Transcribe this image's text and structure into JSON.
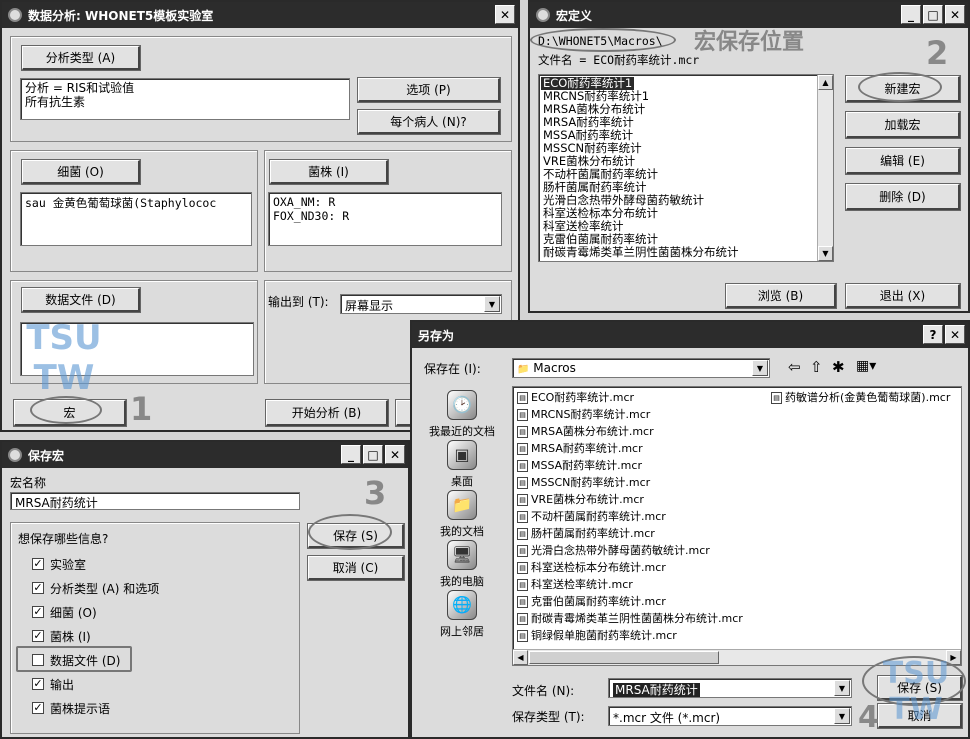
{
  "analysis_window": {
    "title": "数据分析: WHONET5模板实验室",
    "analysis_type_button": "分析类型 (A)",
    "analysis_type_text": [
      "分析 = RIS和试验值",
      "所有抗生素"
    ],
    "options_button": "选项 (P)",
    "per_patient_button": "每个病人 (N)?",
    "organism_button": "细菌 (O)",
    "organism_text": "sau   金黄色葡萄球菌(Staphylococ",
    "strain_button": "菌株 (I)",
    "strain_lines": [
      "OXA_NM:   R",
      "FOX_ND30:  R"
    ],
    "data_file_button": "数据文件 (D)",
    "output_label": "输出到 (T):",
    "output_value": "屏幕显示",
    "macro_button": "宏",
    "start_button": "开始分析 (B)"
  },
  "macro_window": {
    "title": "宏定义",
    "path": "D:\\WHONET5\\Macros\\",
    "filename_line": "文件名 = ECO耐药率统计.mcr",
    "items": [
      "ECO耐药率统计1",
      "MRCNS耐药率统计1",
      "MRSA菌株分布统计",
      "MRSA耐药率统计",
      "MSSA耐药率统计",
      "MSSCN耐药率统计",
      "VRE菌株分布统计",
      "不动杆菌属耐药率统计",
      "肠杆菌属耐药率统计",
      "光滑白念热带外酵母菌药敏统计",
      "科室送检标本分布统计",
      "科室送检率统计",
      "克雷伯菌属耐药率统计",
      "耐碳青霉烯类革兰阴性菌菌株分布统计"
    ],
    "new_button": "新建宏",
    "load_button": "加载宏",
    "edit_button": "编辑 (E)",
    "delete_button": "删除 (D)",
    "browse_button": "浏览 (B)",
    "exit_button": "退出 (X)"
  },
  "save_macro_window": {
    "title": "保存宏",
    "name_label": "宏名称",
    "name_value": "MRSA耐药统计",
    "group_label": "想保存哪些信息?",
    "checks": [
      {
        "label": "实验室",
        "checked": true
      },
      {
        "label": "分析类型 (A) 和选项",
        "checked": true
      },
      {
        "label": "细菌 (O)",
        "checked": true
      },
      {
        "label": "菌株 (I)",
        "checked": true
      },
      {
        "label": "数据文件 (D)",
        "checked": false
      },
      {
        "label": "输出",
        "checked": true
      },
      {
        "label": "菌株提示语",
        "checked": true
      }
    ],
    "save_button": "保存 (S)",
    "cancel_button": "取消 (C)",
    "check_mark": "✓"
  },
  "save_as_dialog": {
    "title": "另存为",
    "save_in_label": "保存在 (I):",
    "save_in_value": "Macros",
    "nav": [
      "我最近的文档",
      "桌面",
      "我的文档",
      "我的电脑",
      "网上邻居"
    ],
    "files_col1": [
      "ECO耐药率统计.mcr",
      "MRCNS耐药率统计.mcr",
      "MRSA菌株分布统计.mcr",
      "MRSA耐药率统计.mcr",
      "MSSA耐药率统计.mcr",
      "MSSCN耐药率统计.mcr",
      "VRE菌株分布统计.mcr",
      "不动杆菌属耐药率统计.mcr",
      "肠杆菌属耐药率统计.mcr",
      "光滑白念热带外酵母菌药敏统计.mcr",
      "科室送检标本分布统计.mcr",
      "科室送检率统计.mcr",
      "克雷伯菌属耐药率统计.mcr",
      "耐碳青霉烯类革兰阴性菌菌株分布统计.mcr",
      "铜绿假单胞菌耐药率统计.mcr"
    ],
    "files_col2": [
      "药敏谱分析(金黄色葡萄球菌).mcr"
    ],
    "filename_label": "文件名 (N):",
    "filename_value": "MRSA耐药统计",
    "filetype_label": "保存类型 (T):",
    "filetype_value": "*.mcr 文件 (*.mcr)",
    "save_button": "保存 (S)",
    "cancel_button": "取消"
  },
  "annotations": {
    "macro_location": "宏保存位置",
    "step1": "1",
    "step2": "2",
    "step3": "3",
    "step4": "4"
  },
  "watermark": "TSU TW",
  "icons": {
    "minimize": "_",
    "maximize": "□",
    "close": "✕",
    "help": "?",
    "dropdown": "▼",
    "scroll_up": "▲",
    "scroll_down": "▼",
    "scroll_left": "◀",
    "scroll_right": "▶",
    "back": "⇦",
    "up_folder": "⇧",
    "new_folder": "✱",
    "views": "▦▾",
    "file": "▤",
    "recent": "🕑",
    "desktop": "▣",
    "docs": "📁",
    "computer": "🖥",
    "network": "🌐",
    "folder": "📁"
  }
}
